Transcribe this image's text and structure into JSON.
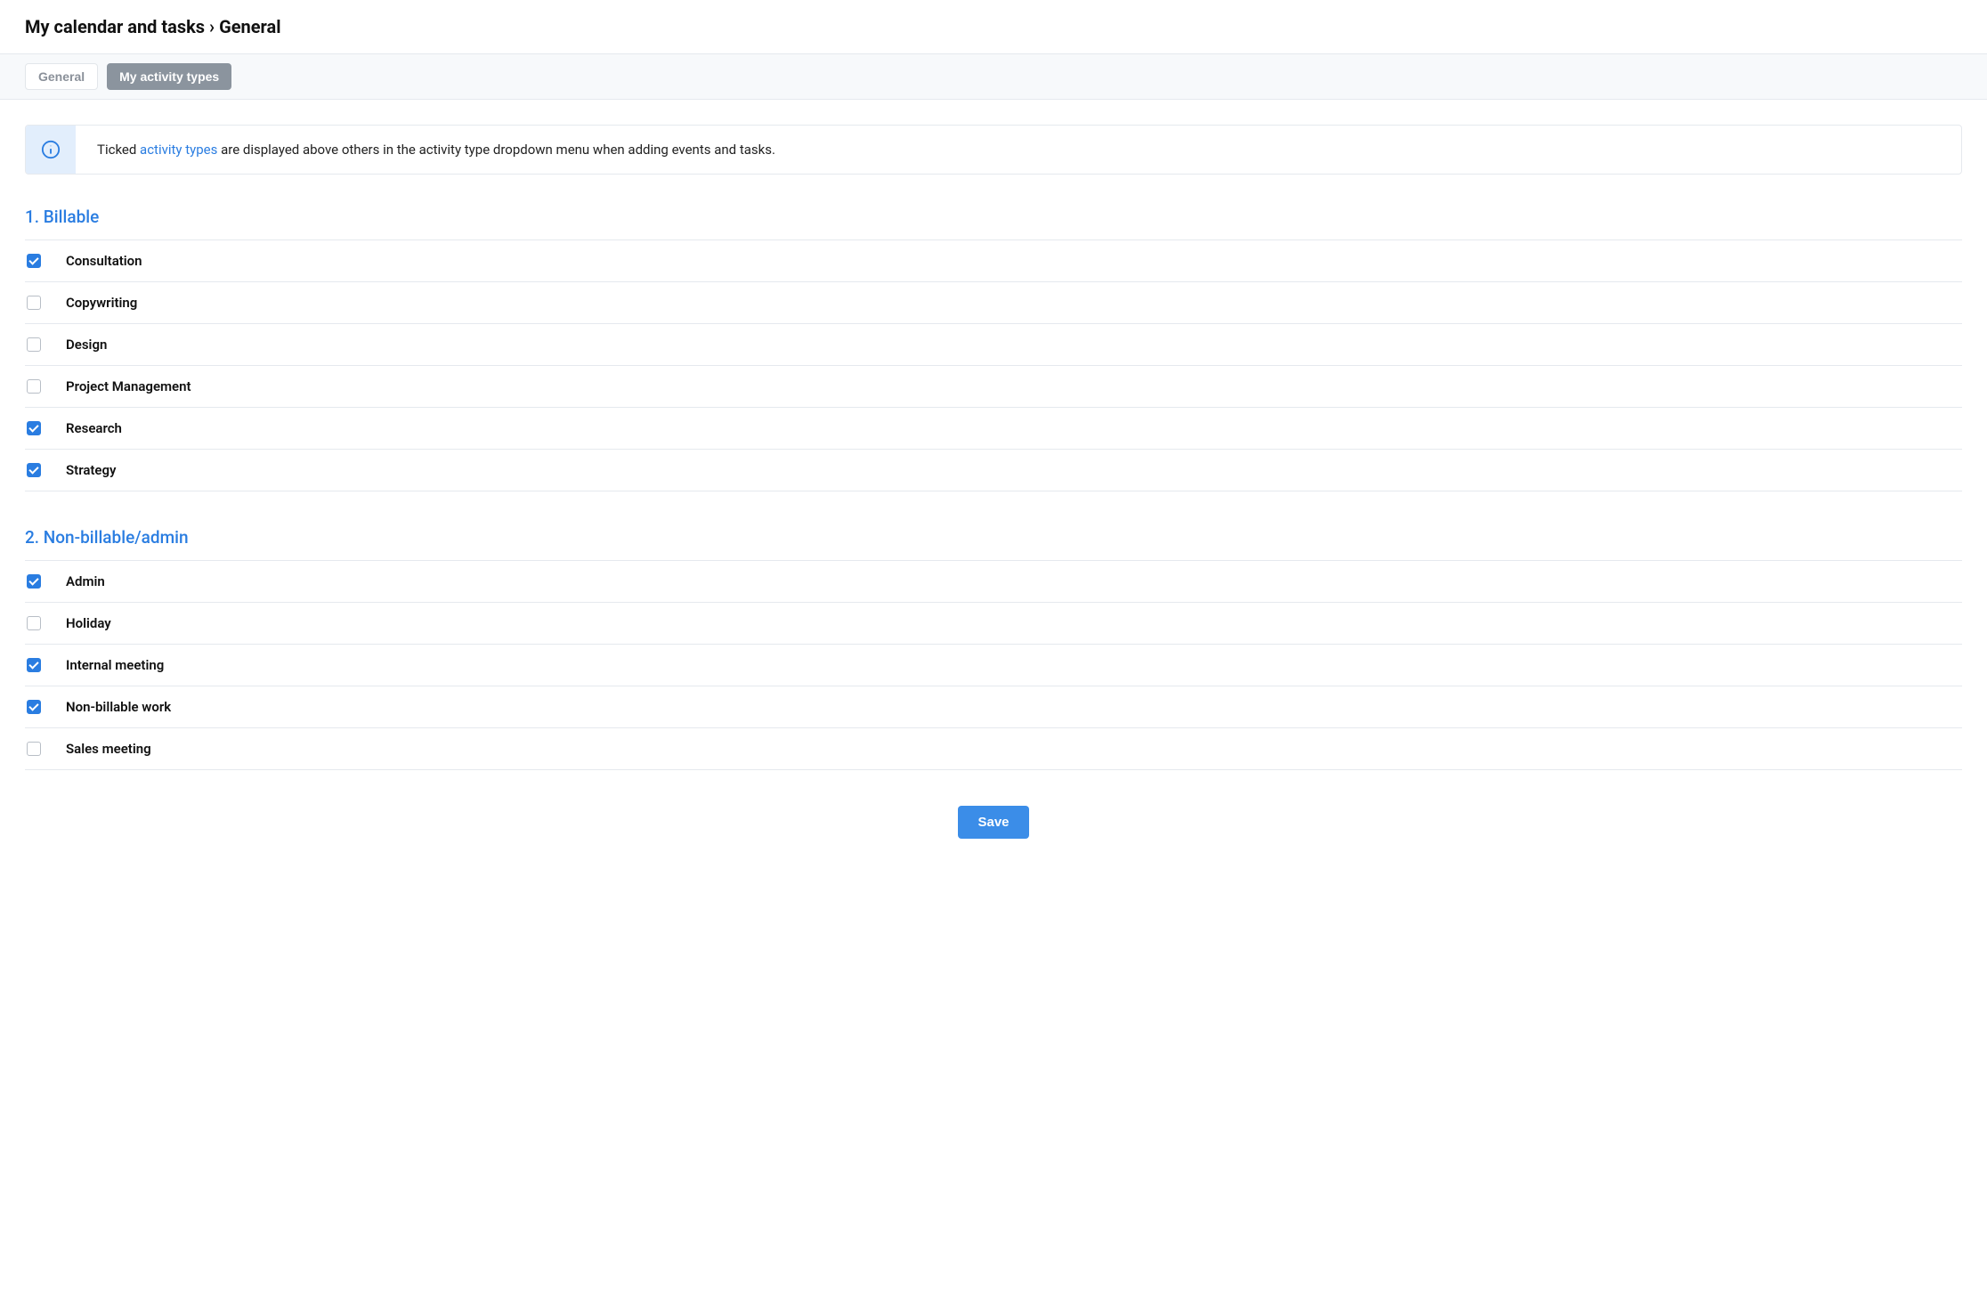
{
  "header": {
    "title": "My calendar and tasks › General"
  },
  "tabs": [
    {
      "label": "General",
      "active": false
    },
    {
      "label": "My activity types",
      "active": true
    }
  ],
  "info": {
    "pre": "Ticked ",
    "link": "activity types",
    "post": " are displayed above others in the activity type dropdown menu when adding events and tasks."
  },
  "sections": [
    {
      "title": "1. Billable",
      "items": [
        {
          "label": "Consultation",
          "checked": true
        },
        {
          "label": "Copywriting",
          "checked": false
        },
        {
          "label": "Design",
          "checked": false
        },
        {
          "label": "Project Management",
          "checked": false
        },
        {
          "label": "Research",
          "checked": true
        },
        {
          "label": "Strategy",
          "checked": true
        }
      ]
    },
    {
      "title": "2. Non-billable/admin",
      "items": [
        {
          "label": "Admin",
          "checked": true
        },
        {
          "label": "Holiday",
          "checked": false
        },
        {
          "label": "Internal meeting",
          "checked": true
        },
        {
          "label": "Non-billable work",
          "checked": true
        },
        {
          "label": "Sales meeting",
          "checked": false
        }
      ]
    }
  ],
  "buttons": {
    "save": "Save"
  }
}
